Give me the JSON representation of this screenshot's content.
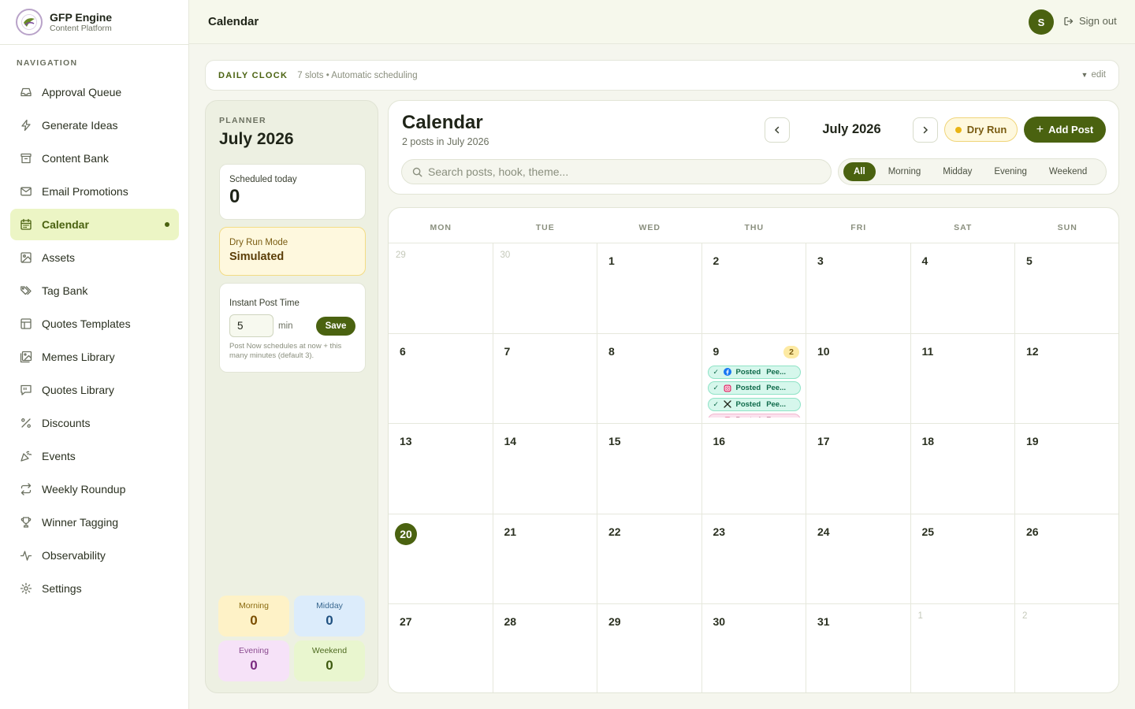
{
  "brand": {
    "title": "GFP Engine",
    "subtitle": "Content Platform"
  },
  "nav": {
    "heading": "NAVIGATION",
    "items": [
      {
        "label": "Approval Queue",
        "icon": "inbox-icon"
      },
      {
        "label": "Generate Ideas",
        "icon": "bolt-icon"
      },
      {
        "label": "Content Bank",
        "icon": "archive-icon"
      },
      {
        "label": "Email Promotions",
        "icon": "mail-icon"
      },
      {
        "label": "Calendar",
        "icon": "calendar-icon",
        "active": true
      },
      {
        "label": "Assets",
        "icon": "image-icon"
      },
      {
        "label": "Tag Bank",
        "icon": "tags-icon"
      },
      {
        "label": "Quotes Templates",
        "icon": "layout-icon"
      },
      {
        "label": "Memes Library",
        "icon": "images-icon"
      },
      {
        "label": "Quotes Library",
        "icon": "quote-bubble-icon"
      },
      {
        "label": "Discounts",
        "icon": "percent-icon"
      },
      {
        "label": "Events",
        "icon": "party-icon"
      },
      {
        "label": "Weekly Roundup",
        "icon": "repeat-icon"
      },
      {
        "label": "Winner Tagging",
        "icon": "trophy-icon"
      },
      {
        "label": "Observability",
        "icon": "activity-icon"
      },
      {
        "label": "Settings",
        "icon": "gear-icon"
      }
    ]
  },
  "header": {
    "title": "Calendar",
    "avatar_initial": "S",
    "signout_label": "Sign out"
  },
  "daily_clock": {
    "label": "DAILY CLOCK",
    "meta": "7 slots • Automatic scheduling",
    "edit_label": "edit"
  },
  "planner": {
    "label": "PLANNER",
    "month": "July 2026",
    "scheduled_today": {
      "label": "Scheduled today",
      "value": "0"
    },
    "dry_run": {
      "label": "Dry Run Mode",
      "value": "Simulated"
    },
    "instant_post": {
      "label": "Instant Post Time",
      "value": "5",
      "unit": "min",
      "save_label": "Save",
      "help": "Post Now schedules at now + this many minutes (default 3)."
    },
    "stats": {
      "morning": {
        "label": "Morning",
        "value": "0"
      },
      "midday": {
        "label": "Midday",
        "value": "0"
      },
      "evening": {
        "label": "Evening",
        "value": "0"
      },
      "weekend": {
        "label": "Weekend",
        "value": "0"
      }
    }
  },
  "calendar": {
    "title": "Calendar",
    "subtitle": "2 posts in July 2026",
    "month": "July 2026",
    "dry_run_label": "Dry Run",
    "add_post_label": "Add Post",
    "search_placeholder": "Search posts, hook, theme...",
    "filters": [
      "All",
      "Morning",
      "Midday",
      "Evening",
      "Weekend"
    ],
    "active_filter": "All",
    "weekdays": [
      "MON",
      "TUE",
      "WED",
      "THU",
      "FRI",
      "SAT",
      "SUN"
    ],
    "weeks": [
      [
        {
          "d": "29",
          "muted": true
        },
        {
          "d": "30",
          "muted": true
        },
        {
          "d": "1"
        },
        {
          "d": "2"
        },
        {
          "d": "3"
        },
        {
          "d": "4"
        },
        {
          "d": "5"
        }
      ],
      [
        {
          "d": "6"
        },
        {
          "d": "7"
        },
        {
          "d": "8"
        },
        {
          "d": "9",
          "badge": "2",
          "events": [
            {
              "platform": "facebook",
              "status": "Posted",
              "title": "Pee...",
              "tone": "green"
            },
            {
              "platform": "instagram",
              "status": "Posted",
              "title": "Pee...",
              "tone": "green"
            },
            {
              "platform": "x",
              "status": "Posted",
              "title": "Pee...",
              "tone": "green"
            },
            {
              "platform": "instagram",
              "status": "Posted",
              "title": "Fra...",
              "tone": "pink"
            }
          ]
        },
        {
          "d": "10"
        },
        {
          "d": "11"
        },
        {
          "d": "12"
        }
      ],
      [
        {
          "d": "13"
        },
        {
          "d": "14"
        },
        {
          "d": "15"
        },
        {
          "d": "16"
        },
        {
          "d": "17"
        },
        {
          "d": "18"
        },
        {
          "d": "19"
        }
      ],
      [
        {
          "d": "20",
          "today": true
        },
        {
          "d": "21"
        },
        {
          "d": "22"
        },
        {
          "d": "23"
        },
        {
          "d": "24"
        },
        {
          "d": "25"
        },
        {
          "d": "26"
        }
      ],
      [
        {
          "d": "27"
        },
        {
          "d": "28"
        },
        {
          "d": "29"
        },
        {
          "d": "30"
        },
        {
          "d": "31"
        },
        {
          "d": "1",
          "muted": true
        },
        {
          "d": "2",
          "muted": true
        }
      ]
    ]
  },
  "colors": {
    "accent": "#4a6210",
    "active_nav_bg": "#ecf5c5",
    "dry_run_bg": "#fef8de",
    "posted_green": "#d6f7ec",
    "posted_pink": "#fbe2ee"
  }
}
